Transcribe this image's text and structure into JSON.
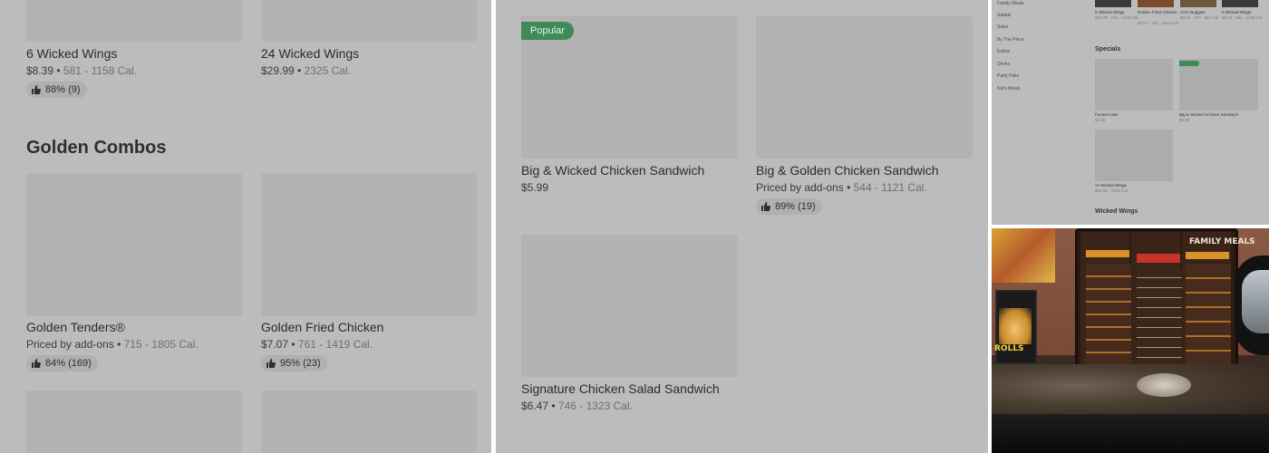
{
  "left": {
    "items_top": [
      {
        "title": "6 Wicked Wings",
        "price": "$8.39",
        "cal": "581 - 1158 Cal.",
        "rating": "88% (9)"
      },
      {
        "title": "24 Wicked Wings",
        "price": "$29.99",
        "cal": "2325 Cal."
      }
    ],
    "section_golden_combos": "Golden Combos",
    "combos": [
      {
        "title": "Golden Tenders®",
        "price": "Priced by add-ons",
        "cal": "715 - 1805 Cal.",
        "rating": "84% (169)"
      },
      {
        "title": "Golden Fried Chicken",
        "price": "$7.07",
        "cal": "761 - 1419 Cal.",
        "rating": "95% (23)"
      }
    ]
  },
  "middle": {
    "popular_label": "Popular",
    "items": [
      {
        "title": "Big & Wicked Chicken Sandwich",
        "price": "$5.99"
      },
      {
        "title": "Big & Golden Chicken Sandwich",
        "price": "Priced by add-ons",
        "cal": "544 - 1121 Cal.",
        "rating": "89% (19)"
      },
      {
        "title": "Signature Chicken Salad Sandwich",
        "price": "$6.47",
        "cal": "746 - 1323 Cal."
      }
    ]
  },
  "top_right": {
    "sidebar": [
      "Family Meals",
      "Salads",
      "Sides",
      "By The Piece",
      "Extras",
      "Drinks",
      "Party Paks",
      "Kid's Meals"
    ],
    "top_row": [
      {
        "title": "6 Wicked Wings",
        "meta": "$12.79 · 781 - 1464 Cal."
      },
      {
        "title": "Golden Fried Chicken",
        "meta": "$7.07 · 761 - 1419 Cal."
      },
      {
        "title": "Corn Nuggets",
        "meta": "$3.83 · 277 - 554 Cal."
      },
      {
        "title": "6 Wicked Wings",
        "meta": "$8.39 · 581 - 1158 Cal."
      }
    ],
    "specials_heading": "Specials",
    "specials": [
      {
        "title": "Funnel Cake",
        "meta": "$2.59"
      },
      {
        "title": "Big & Wicked Chicken Sandwich",
        "meta": "$5.99"
      },
      {
        "title": "24 Wicked Wings",
        "meta": "$29.99 · 2325 Cal."
      }
    ],
    "wings_heading": "Wicked Wings"
  },
  "photo": {
    "rolls_text": "ROLLS",
    "family_meals_text": "FAMILY MEALS"
  },
  "colors": {
    "overlay_gray": "#bcbcbc",
    "popular_green": "#3f8a57"
  },
  "icons": {
    "rating": "thumbs-up-icon"
  }
}
